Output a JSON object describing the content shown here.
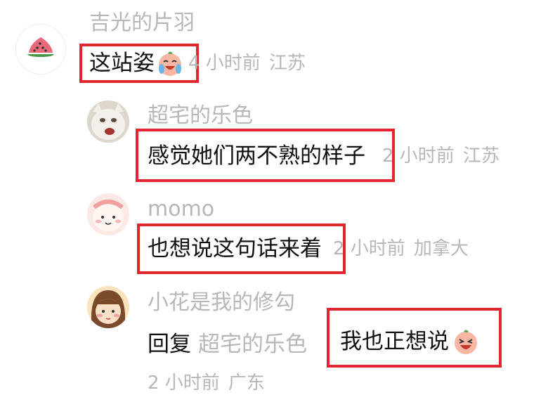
{
  "comments": [
    {
      "user": "吉光的片羽",
      "text": "这站姿",
      "time": "4 小时前",
      "location": "江苏",
      "avatar_icon": "watermelon-icon",
      "emoji_icon": "crying-laugh-emoji-icon"
    },
    {
      "user": "超宅的乐色",
      "text": "感觉她们两不熟的样子",
      "time": "2 小时前",
      "location": "江苏",
      "avatar_icon": "cat-avatar-icon"
    },
    {
      "user": "momo",
      "text": "也想说这句话来着",
      "time": "2 小时前",
      "location": "加拿大",
      "avatar_icon": "pink-cartoon-avatar-icon"
    },
    {
      "user": "小花是我的修勾",
      "reply_label": "回复",
      "reply_to": "超宅的乐色",
      "text": "我也正想说",
      "time": "2 小时前",
      "location": "广东",
      "avatar_icon": "cartoon-girl-avatar-icon",
      "emoji_icon": "laughing-emoji-icon"
    }
  ],
  "colors": {
    "highlight": "#e0262e",
    "muted_text": "#b7b7b7",
    "main_text": "#111111"
  }
}
